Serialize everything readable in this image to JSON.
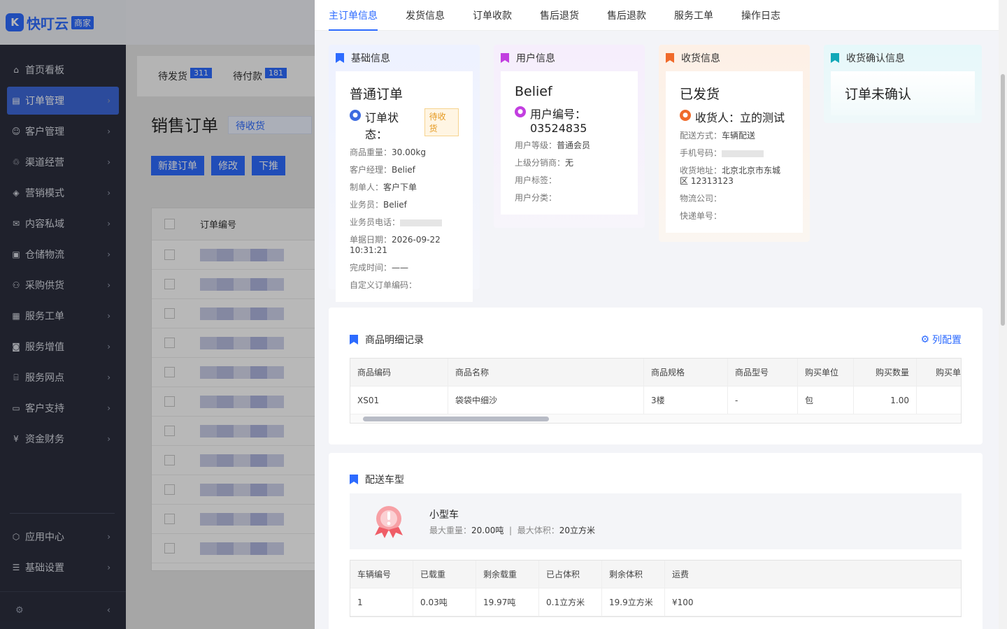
{
  "app": {
    "logo_mark": "K",
    "logo_text": "快叮云",
    "logo_badge": "商家"
  },
  "sidebar": {
    "items": [
      {
        "label": "首页看板",
        "icon": "home-icon"
      },
      {
        "label": "订单管理",
        "icon": "order-icon",
        "active": true
      },
      {
        "label": "客户管理",
        "icon": "user-icon"
      },
      {
        "label": "渠道经营",
        "icon": "channel-icon"
      },
      {
        "label": "营销模式",
        "icon": "tag-icon"
      },
      {
        "label": "内容私域",
        "icon": "mail-icon"
      },
      {
        "label": "仓储物流",
        "icon": "warehouse-icon"
      },
      {
        "label": "采购供货",
        "icon": "purchase-icon"
      },
      {
        "label": "服务工单",
        "icon": "ticket-icon"
      },
      {
        "label": "服务增值",
        "icon": "bag-icon"
      },
      {
        "label": "服务网点",
        "icon": "shop-icon"
      },
      {
        "label": "客户支持",
        "icon": "support-icon"
      },
      {
        "label": "资金财务",
        "icon": "yuan-icon"
      }
    ],
    "bottom_items": [
      {
        "label": "应用中心",
        "icon": "cube-icon"
      },
      {
        "label": "基础设置",
        "icon": "settings-icon"
      }
    ]
  },
  "bg": {
    "tabs": [
      {
        "label": "待发货",
        "count": "311"
      },
      {
        "label": "待付款",
        "count": "181"
      }
    ],
    "title": "销售订单",
    "select": "待收货",
    "buttons": [
      "新建订单",
      "修改",
      "下推"
    ],
    "col": "订单编号"
  },
  "drawer": {
    "tabs": [
      "主订单信息",
      "发货信息",
      "订单收款",
      "售后退货",
      "售后退款",
      "服务工单",
      "操作日志"
    ],
    "basic": {
      "head": "基础信息",
      "title": "普通订单",
      "status_label": "订单状态：",
      "status": "待收货",
      "rows": [
        [
          "商品重量：",
          "30.00kg"
        ],
        [
          "客户经理：",
          "Belief"
        ],
        [
          "制单人：",
          "客户下单"
        ],
        [
          "业务员：",
          "Belief"
        ]
      ],
      "phone_label": "业务员电话：",
      "date_label": "单据日期：",
      "date": "2026-09-22 10:31:21",
      "done_label": "完成时间：",
      "done": "——",
      "custom_label": "自定义订单编码："
    },
    "user": {
      "head": "用户信息",
      "title": "Belief",
      "code_label": "用户编号：",
      "code": "03524835",
      "rows": [
        [
          "用户等级：",
          "普通会员"
        ],
        [
          "上级分销商：",
          "无"
        ],
        [
          "用户标签：",
          ""
        ],
        [
          "用户分类：",
          ""
        ]
      ]
    },
    "receive": {
      "head": "收货信息",
      "title": "已发货",
      "receiver_label": "收货人：",
      "receiver": "立的测试",
      "delivery_label": "配送方式：",
      "delivery": "车辆配送",
      "phone_label": "手机号码：",
      "addr_label": "收货地址：",
      "addr": "北京北京市东城区 12313123",
      "logi_label": "物流公司：",
      "exp_label": "快递单号："
    },
    "confirm": {
      "head": "收货确认信息",
      "title": "订单未确认"
    },
    "goods": {
      "head": "商品明细记录",
      "config": "列配置",
      "cols": [
        "商品编码",
        "商品名称",
        "商品规格",
        "商品型号",
        "购买单位",
        "购买数量",
        "购买单"
      ],
      "rows": [
        [
          "XS01",
          "袋袋中细沙",
          "3楼",
          "-",
          "包",
          "1.00",
          ""
        ]
      ]
    },
    "vehicle": {
      "head": "配送车型",
      "name": "小型车",
      "weight_label": "最大重量：",
      "weight": "20.00吨",
      "sep": "|",
      "volume_label": "最大体积：",
      "volume": "20立方米",
      "cols": [
        "车辆编号",
        "已载重",
        "剩余载重",
        "已占体积",
        "剩余体积",
        "运费"
      ],
      "rows": [
        [
          "1",
          "0.03吨",
          "19.97吨",
          "0.1立方米",
          "19.9立方米",
          "¥100"
        ]
      ]
    }
  },
  "colors": {
    "primary": "#2d6bff",
    "sidebar": "#2b2f3e",
    "warning": "#e59a22"
  }
}
